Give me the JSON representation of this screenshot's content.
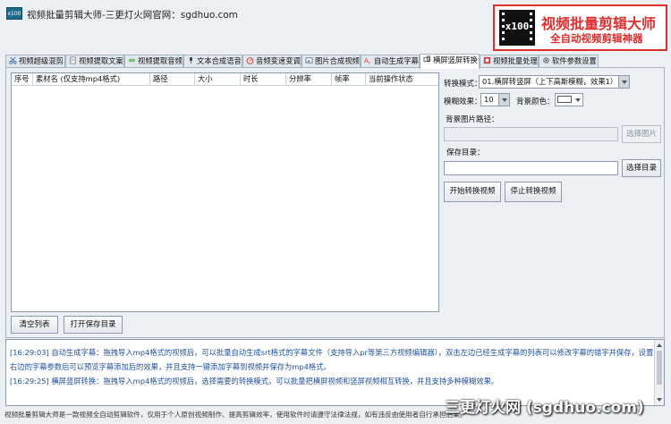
{
  "window": {
    "title": "视频批量剪辑大师-三更灯火网官网：sgdhuo.com",
    "icon_text": "x100"
  },
  "brand": {
    "title": "视频批量剪辑大师",
    "subtitle": "全自动视频剪辑神器",
    "logo_text": "x100",
    "color": "#e02d2d"
  },
  "tabs": [
    {
      "label": "视频超级混剪",
      "icon": "scissors-icon"
    },
    {
      "label": "视频提取文案",
      "icon": "document-icon"
    },
    {
      "label": "视频提取音频",
      "icon": "audio-extract-icon"
    },
    {
      "label": "文本合成语音",
      "icon": "microphone-icon"
    },
    {
      "label": "音频变速变调",
      "icon": "gauge-icon"
    },
    {
      "label": "图片合成视频",
      "icon": "image-icon"
    },
    {
      "label": "自动生成字幕",
      "icon": "subtitle-icon"
    },
    {
      "label": "横屏竖屏转换",
      "icon": "rotate-screen-icon",
      "active": true
    },
    {
      "label": "视频批量处理",
      "icon": "film-icon"
    },
    {
      "label": "软件参数设置",
      "icon": "gear-icon"
    }
  ],
  "table": {
    "columns": [
      "序号",
      "素材名 (仅支持mp4格式)",
      "路径",
      "大小",
      "时长",
      "分辨率",
      "帧率",
      "当前操作状态"
    ]
  },
  "buttons": {
    "clear_list": "清空列表",
    "open_save_dir": "打开保存目录",
    "select_image": "选择图片",
    "select_dir": "选择目录",
    "start": "开始转换视频",
    "stop": "停止转换视频"
  },
  "settings": {
    "mode_label": "转换模式：",
    "mode_value": "01.横屏转竖屏（上下高斯模糊，效果1）",
    "blur_label": "模糊效果：",
    "blur_value": "10",
    "bg_color_label": "背景颜色：",
    "bg_image_label": "背景图片路径：",
    "bg_image_value": "",
    "save_dir_label": "保存目录：",
    "save_dir_value": ""
  },
  "log": {
    "lines": [
      "[16:29:03] 自动生成字幕：拖拽导入mp4格式的视频后，可以批量自动生成srt格式的字幕文件（支持导入pr等第三方视频编辑器），双击左边已经生成字幕的列表可以修改字幕的错字并保存，设置",
      "右边的字幕参数后可以预览字幕添加后的效果，并且支持一键添加字幕到视频并保存为mp4格式。",
      "[16:29:25] 横屏竖屏转换：拖拽导入mp4格式的视频后，选择需要的转换模式，可以批量把横屏视频和竖屏视频相互转换，并且支持多种模糊效果。"
    ]
  },
  "status_bar": "视频批量剪辑大师是一款视频全自动剪辑软件，仅用于个人原创视频制作、提高剪辑效率，使用软件时请遵守法律法规，如有违反由使用者自行承担后果。",
  "watermark": "三更灯火网 (sgdhuo.com)"
}
